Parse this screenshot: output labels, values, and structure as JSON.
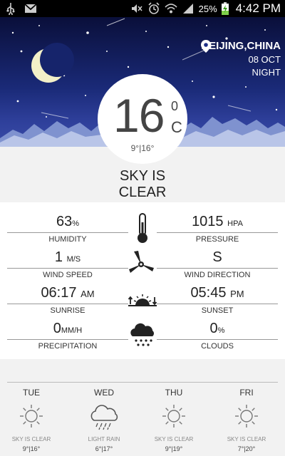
{
  "status": {
    "battery": "25%",
    "time": "4:42 PM"
  },
  "location": {
    "city": "BEIJING,CHINA",
    "date": "08 OCT",
    "period": "NIGHT"
  },
  "current": {
    "temp": "16",
    "deg": "0",
    "unit": "C",
    "range": "9°|16°",
    "condition_line1": "SKY IS",
    "condition_line2": "CLEAR"
  },
  "details": {
    "humidity": {
      "value": "63",
      "unit": "%",
      "label": "HUMIDITY"
    },
    "pressure": {
      "value": "1015",
      "unit": "HPA",
      "label": "PRESSURE"
    },
    "wind_speed": {
      "value": "1",
      "unit": "M/S",
      "label": "WIND SPEED"
    },
    "wind_direction": {
      "value": "S",
      "unit": "",
      "label": "WIND DIRECTION"
    },
    "sunrise": {
      "value": "06:17",
      "unit": "AM",
      "label": "SUNRISE"
    },
    "sunset": {
      "value": "05:45",
      "unit": "PM",
      "label": "SUNSET"
    },
    "precipitation": {
      "value": "0",
      "unit": "MM/H",
      "label": "PRECIPITATION"
    },
    "clouds": {
      "value": "0",
      "unit": "%",
      "label": "CLOUDS"
    }
  },
  "forecast": [
    {
      "day": "TUE",
      "icon": "sun-icon",
      "condition": "SKY IS CLEAR",
      "range": "9°|16°"
    },
    {
      "day": "WED",
      "icon": "rain-cloud-icon",
      "condition": "LIGHT RAIN",
      "range": "6°|17°"
    },
    {
      "day": "THU",
      "icon": "sun-icon",
      "condition": "SKY IS CLEAR",
      "range": "9°|19°"
    },
    {
      "day": "FRI",
      "icon": "sun-icon",
      "condition": "SKY IS CLEAR",
      "range": "7°|20°"
    }
  ]
}
